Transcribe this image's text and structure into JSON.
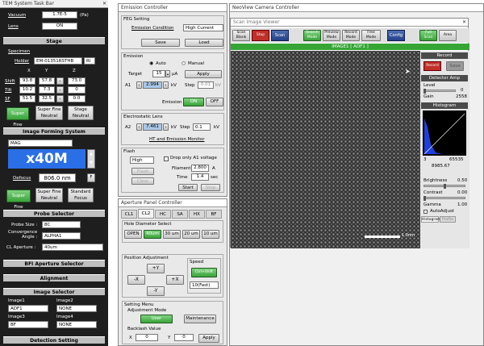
{
  "taskbar": {
    "title": "TEM System Task Bar",
    "vacuum_label": "Vacuum",
    "vacuum_value": "1.7E-5",
    "vacuum_unit": "(Pa)",
    "lens_label": "Lens",
    "lens_value": "ON",
    "stage": {
      "header": "Stage",
      "specimen_label": "Specimen",
      "holder_label": "Holder",
      "holder_value": "EM-01351RSTHB",
      "holder_extra": "Rl",
      "axis_x": "X",
      "axis_y": "Y",
      "axis_z": "Z",
      "shift_label": "Shift",
      "tilt_label": "Tilt",
      "sf_label": "SF",
      "shift": [
        "93.8",
        "57.8",
        "73.0"
      ],
      "tilt": [
        "10.2",
        "7.3",
        "0"
      ],
      "sf": [
        "51.5",
        "32.5",
        "0.0"
      ],
      "super_fine_btn": "Super Fine",
      "super_fine_neutral_btn": "Super Fine\nNeutral",
      "stage_neutral_btn": "Stage\nNeutral"
    },
    "image_forming": {
      "header": "Image Forming System",
      "mode": "MAG",
      "magnification": "x40M",
      "defocus_label": "Defocus",
      "defocus_value": "806.0 nm",
      "f_btn": "F",
      "super_fine_btn": "Super Fine",
      "super_fine_neutral_btn": "Super Fine\nNeutral",
      "standard_focus_btn": "Standard\nFocus"
    },
    "probe": {
      "header": "Probe Selector",
      "probe_size_label": "Probe Size :",
      "probe_size_value": "8C",
      "conv_angle_label": "Convergence\nAngle :",
      "conv_angle_value": "ALPHA1",
      "cl_aperture_label": "CL Aperture :",
      "cl_aperture_value": "40um"
    },
    "bfi_header": "BFI Aperture Selector",
    "alignment_header": "Alignment",
    "image_selector": {
      "header": "Image Selector",
      "image1_label": "Image1",
      "image1_value": "ADF1",
      "image2_label": "Image2",
      "image2_value": "NONE",
      "image3_label": "Image3",
      "image3_value": "BF",
      "image4_label": "Image4",
      "image4_value": "NONE"
    },
    "detection_header": "Detection Setting"
  },
  "emission": {
    "title": "Emission Controller",
    "feg_label": "FEG Setting",
    "emission_condition_label": "Emission Condition",
    "emission_condition_value": "High Current",
    "save_btn": "Save",
    "load_btn": "Load",
    "emission_label": "Emission",
    "auto_label": "Auto",
    "manual_label": "Manual",
    "target_label": "Target",
    "target_value": "15",
    "target_unit": "µA",
    "apply_btn": "Apply",
    "a1_label": "A1",
    "a1_value": "2.994",
    "kv_unit": "kV",
    "step_label": "Step",
    "step_value": "0.01",
    "emission_toggle_label": "Emission",
    "on_btn": "ON",
    "off_btn": "OFF",
    "electrostatic_label": "Electrostatic Lens",
    "a2_label": "A2",
    "a2_value": "7.461",
    "a2_step_value": "0.1",
    "ht_link": "HT and Emission Monitor",
    "flash_label": "Flash",
    "flash_level": "High",
    "drop_only_label": "Drop only A1 voltage",
    "filament_label": "Filament",
    "filament_value": "2.800",
    "filament_unit": "A",
    "time_label": "Time",
    "time_value": "1.4",
    "time_unit": "sec",
    "start_btn": "Start",
    "stop_btn": "Stop",
    "dim_btn1": "Flash",
    "dim_btn2": "Clear"
  },
  "aperture": {
    "title": "Aperture Panel Controller",
    "tabs": [
      "CL1",
      "CL2",
      "HC",
      "SA",
      "HX",
      "BF"
    ],
    "hole_label": "Hole Diameter Select",
    "holes": [
      "OPEN",
      "40um",
      "30 um",
      "20 um",
      "10 um"
    ],
    "position_label": "Position Adjustment",
    "plus_y": "+Y",
    "minus_y": "-Y",
    "plus_x": "+X",
    "minus_x": "-X",
    "speed_label": "Speed",
    "speed_btn": "Ctrl+Shift",
    "speed_value": "10(Fast)",
    "setting_label": "Setting Menu",
    "adj_mode_label": "Adjustment Mode",
    "user_btn": "User",
    "maintenance_btn": "Maintenance",
    "backlash_label": "Backlash Value",
    "x_label": "X",
    "x_value": "0",
    "y_label": "Y",
    "y_value": "0",
    "apply_btn": "Apply"
  },
  "viewer": {
    "title": "NeoView Camera Controller",
    "subtitle": "Scan Image Viewer",
    "toolbar": [
      "Scan\nBlank",
      "Stop",
      "Scan",
      "Search\nMode",
      "Preview\nMode",
      "Record\nMode",
      "Free\nMode",
      "Config",
      "Full\nScan",
      "Area"
    ],
    "image_label": "IMAGE1 [ ADF1 ]",
    "scale_label": "1.0nm",
    "record": {
      "header": "Record",
      "btn1": "Record",
      "btn2": "Save"
    },
    "detector": {
      "header": "Detector Amp",
      "level_label": "Level",
      "level_value": "0",
      "gain_label": "Gain",
      "gain_value": "2558"
    },
    "histogram": {
      "header": "Histogram",
      "min": "3",
      "max": "65535",
      "mean": "8985.67",
      "brightness_label": "Brightness",
      "brightness_value": "0.50",
      "contrast_label": "Contrast",
      "contrast_value": "0.00",
      "gamma_label": "Gamma",
      "gamma_value": "1.00",
      "autoadjust_label": "AutoAdjust",
      "tab1": "Histogram",
      "tab2": "Profile"
    }
  },
  "colors": {
    "green": "#2fa12f",
    "blue_display": "#2b6fe6",
    "dark": "#1a1a1a"
  }
}
